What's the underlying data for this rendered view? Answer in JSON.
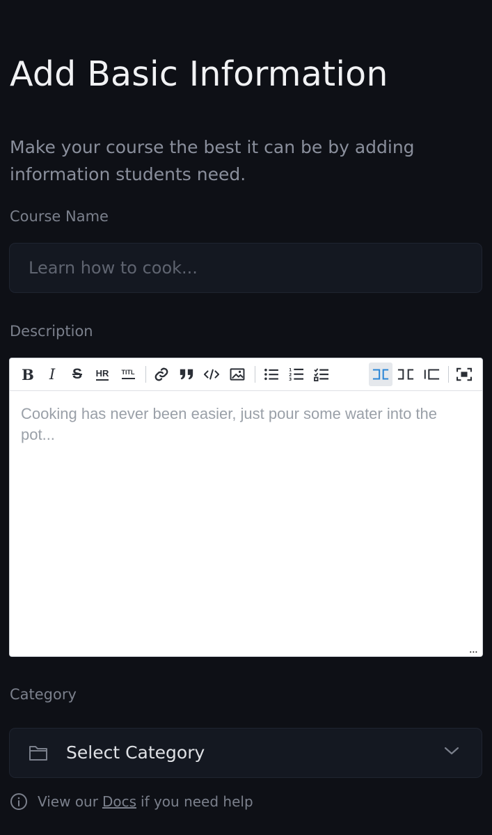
{
  "page": {
    "title": "Add Basic Information",
    "subtitle": "Make your course the best it can be by adding information students need."
  },
  "course_name": {
    "label": "Course Name",
    "value": "",
    "placeholder": "Learn how to cook..."
  },
  "description": {
    "label": "Description",
    "value": "",
    "placeholder": "Cooking has never been easier, just pour some water into the pot...",
    "toolbar": {
      "active_tool": "side-by-side",
      "tools": [
        "bold-icon",
        "italic-icon",
        "strikethrough-icon",
        "horizontal-rule-icon",
        "heading-icon",
        "link-icon",
        "quote-icon",
        "code-icon",
        "image-icon",
        "unordered-list-icon",
        "ordered-list-icon",
        "checklist-icon",
        "side-by-side-icon",
        "preview-icon",
        "edit-mode-icon",
        "fullscreen-icon"
      ],
      "hr_glyph": "HR",
      "heading_glyph": "TITL"
    },
    "resize_glyph": "..."
  },
  "category": {
    "label": "Category",
    "selected": "Select Category"
  },
  "help": {
    "prefix": "View our",
    "link": "Docs",
    "suffix": "if you need help"
  },
  "colors": {
    "background": "#0e1016",
    "field_background": "#141821",
    "accent": "#2b86d6"
  }
}
